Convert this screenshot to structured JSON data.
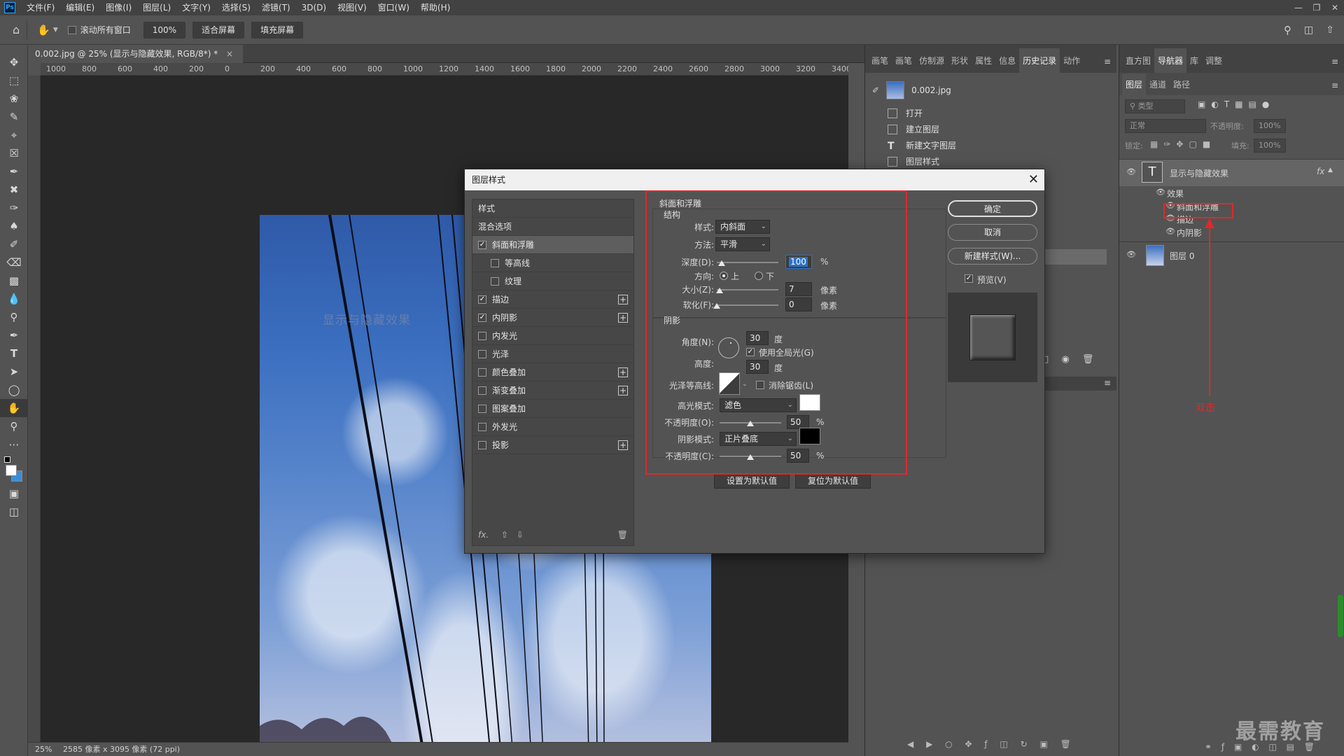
{
  "menubar": {
    "app_badge": "Ps",
    "items": [
      "文件(F)",
      "编辑(E)",
      "图像(I)",
      "图层(L)",
      "文字(Y)",
      "选择(S)",
      "滤镜(T)",
      "3D(D)",
      "视图(V)",
      "窗口(W)",
      "帮助(H)"
    ]
  },
  "optionsbar": {
    "scroll_all_label": "滚动所有窗口",
    "zoom_value": "100%",
    "fit_screen": "适合屏幕",
    "fill_screen": "填充屏幕"
  },
  "document": {
    "tab_title": "0.002.jpg @ 25% (显示与隐藏效果, RGB/8*) *",
    "ruler_labels": [
      "1000",
      "800",
      "600",
      "400",
      "200",
      "0",
      "200",
      "400",
      "600",
      "800",
      "1000",
      "1200",
      "1400",
      "1600",
      "1800",
      "2000",
      "2200",
      "2400",
      "2600",
      "2800",
      "3000",
      "3200",
      "3400"
    ],
    "canvas_text": "显示与隐藏效果",
    "status_zoom": "25%",
    "status_info": "2585 像素 x 3095 像素 (72 ppi)"
  },
  "history_panel": {
    "tabs": [
      "画笔",
      "画笔",
      "仿制源",
      "形状",
      "属性",
      "信息",
      "历史记录",
      "动作"
    ],
    "snapshot": "0.002.jpg",
    "items": [
      "打开",
      "建立图层",
      "新建文字图层",
      "图层样式"
    ]
  },
  "layers_panel": {
    "top_tabs": [
      "直方图",
      "导航器",
      "库",
      "调整"
    ],
    "tabs": [
      "图层",
      "通道",
      "路径"
    ],
    "filter_placeholder": "类型",
    "blend_mode": "正常",
    "opacity_label": "不透明度:",
    "opacity_value": "100%",
    "lock_label": "锁定:",
    "fill_label": "填充:",
    "fill_value": "100%",
    "text_layer": "显示与隐藏效果",
    "effects_label": "效果",
    "effects": [
      "斜面和浮雕",
      "描边",
      "内阴影"
    ],
    "image_layer": "图层 0",
    "fx_label": "fx"
  },
  "dialog": {
    "title": "图层样式",
    "style_list": [
      {
        "label": "样式",
        "checkbox": false,
        "checked": false,
        "plus": false
      },
      {
        "label": "混合选项",
        "checkbox": false,
        "checked": false,
        "plus": false
      },
      {
        "label": "斜面和浮雕",
        "checkbox": true,
        "checked": true,
        "plus": false,
        "active": true
      },
      {
        "label": "等高线",
        "checkbox": true,
        "checked": false,
        "plus": false,
        "indent": true
      },
      {
        "label": "纹理",
        "checkbox": true,
        "checked": false,
        "plus": false,
        "indent": true
      },
      {
        "label": "描边",
        "checkbox": true,
        "checked": true,
        "plus": true
      },
      {
        "label": "内阴影",
        "checkbox": true,
        "checked": true,
        "plus": true
      },
      {
        "label": "内发光",
        "checkbox": true,
        "checked": false,
        "plus": false
      },
      {
        "label": "光泽",
        "checkbox": true,
        "checked": false,
        "plus": false
      },
      {
        "label": "颜色叠加",
        "checkbox": true,
        "checked": false,
        "plus": true
      },
      {
        "label": "渐变叠加",
        "checkbox": true,
        "checked": false,
        "plus": true
      },
      {
        "label": "图案叠加",
        "checkbox": true,
        "checked": false,
        "plus": false
      },
      {
        "label": "外发光",
        "checkbox": true,
        "checked": false,
        "plus": false
      },
      {
        "label": "投影",
        "checkbox": true,
        "checked": false,
        "plus": true
      }
    ],
    "fx_footer": "fx.",
    "section_title": "斜面和浮雕",
    "structure": {
      "title": "结构",
      "style_label": "样式:",
      "style_value": "内斜面",
      "technique_label": "方法:",
      "technique_value": "平滑",
      "depth_label": "深度(D):",
      "depth_value": "100",
      "depth_unit": "%",
      "depth_level": 0.08,
      "direction_label": "方向:",
      "dir_up": "上",
      "dir_down": "下",
      "size_label": "大小(Z):",
      "size_value": "7",
      "size_unit": "像素",
      "size_level": 0.05,
      "soften_label": "软化(F):",
      "soften_value": "0",
      "soften_unit": "像素",
      "soften_level": 0.0
    },
    "shading": {
      "title": "阴影",
      "angle_label": "角度(N):",
      "angle_value": "30",
      "angle_unit": "度",
      "global_light": "使用全局光(G)",
      "altitude_label": "高度:",
      "altitude_value": "30",
      "altitude_unit": "度",
      "gloss_label": "光泽等高线:",
      "antialias": "消除锯齿(L)",
      "highlight_label": "高光模式:",
      "highlight_mode": "滤色",
      "highlight_color": "#ffffff",
      "hl_opacity_label": "不透明度(O):",
      "hl_opacity_value": "50",
      "hl_opacity_unit": "%",
      "hl_opacity_level": 0.5,
      "shadow_label": "阴影模式:",
      "shadow_mode": "正片叠底",
      "shadow_color": "#000000",
      "sh_opacity_label": "不透明度(C):",
      "sh_opacity_value": "50",
      "sh_opacity_unit": "%",
      "sh_opacity_level": 0.5
    },
    "make_default": "设置为默认值",
    "reset_default": "复位为默认值",
    "ok": "确定",
    "cancel": "取消",
    "new_style": "新建样式(W)...",
    "preview": "预览(V)"
  },
  "annotation": {
    "text": "双击",
    "color": "#e0282b"
  },
  "watermark": "最需教育"
}
